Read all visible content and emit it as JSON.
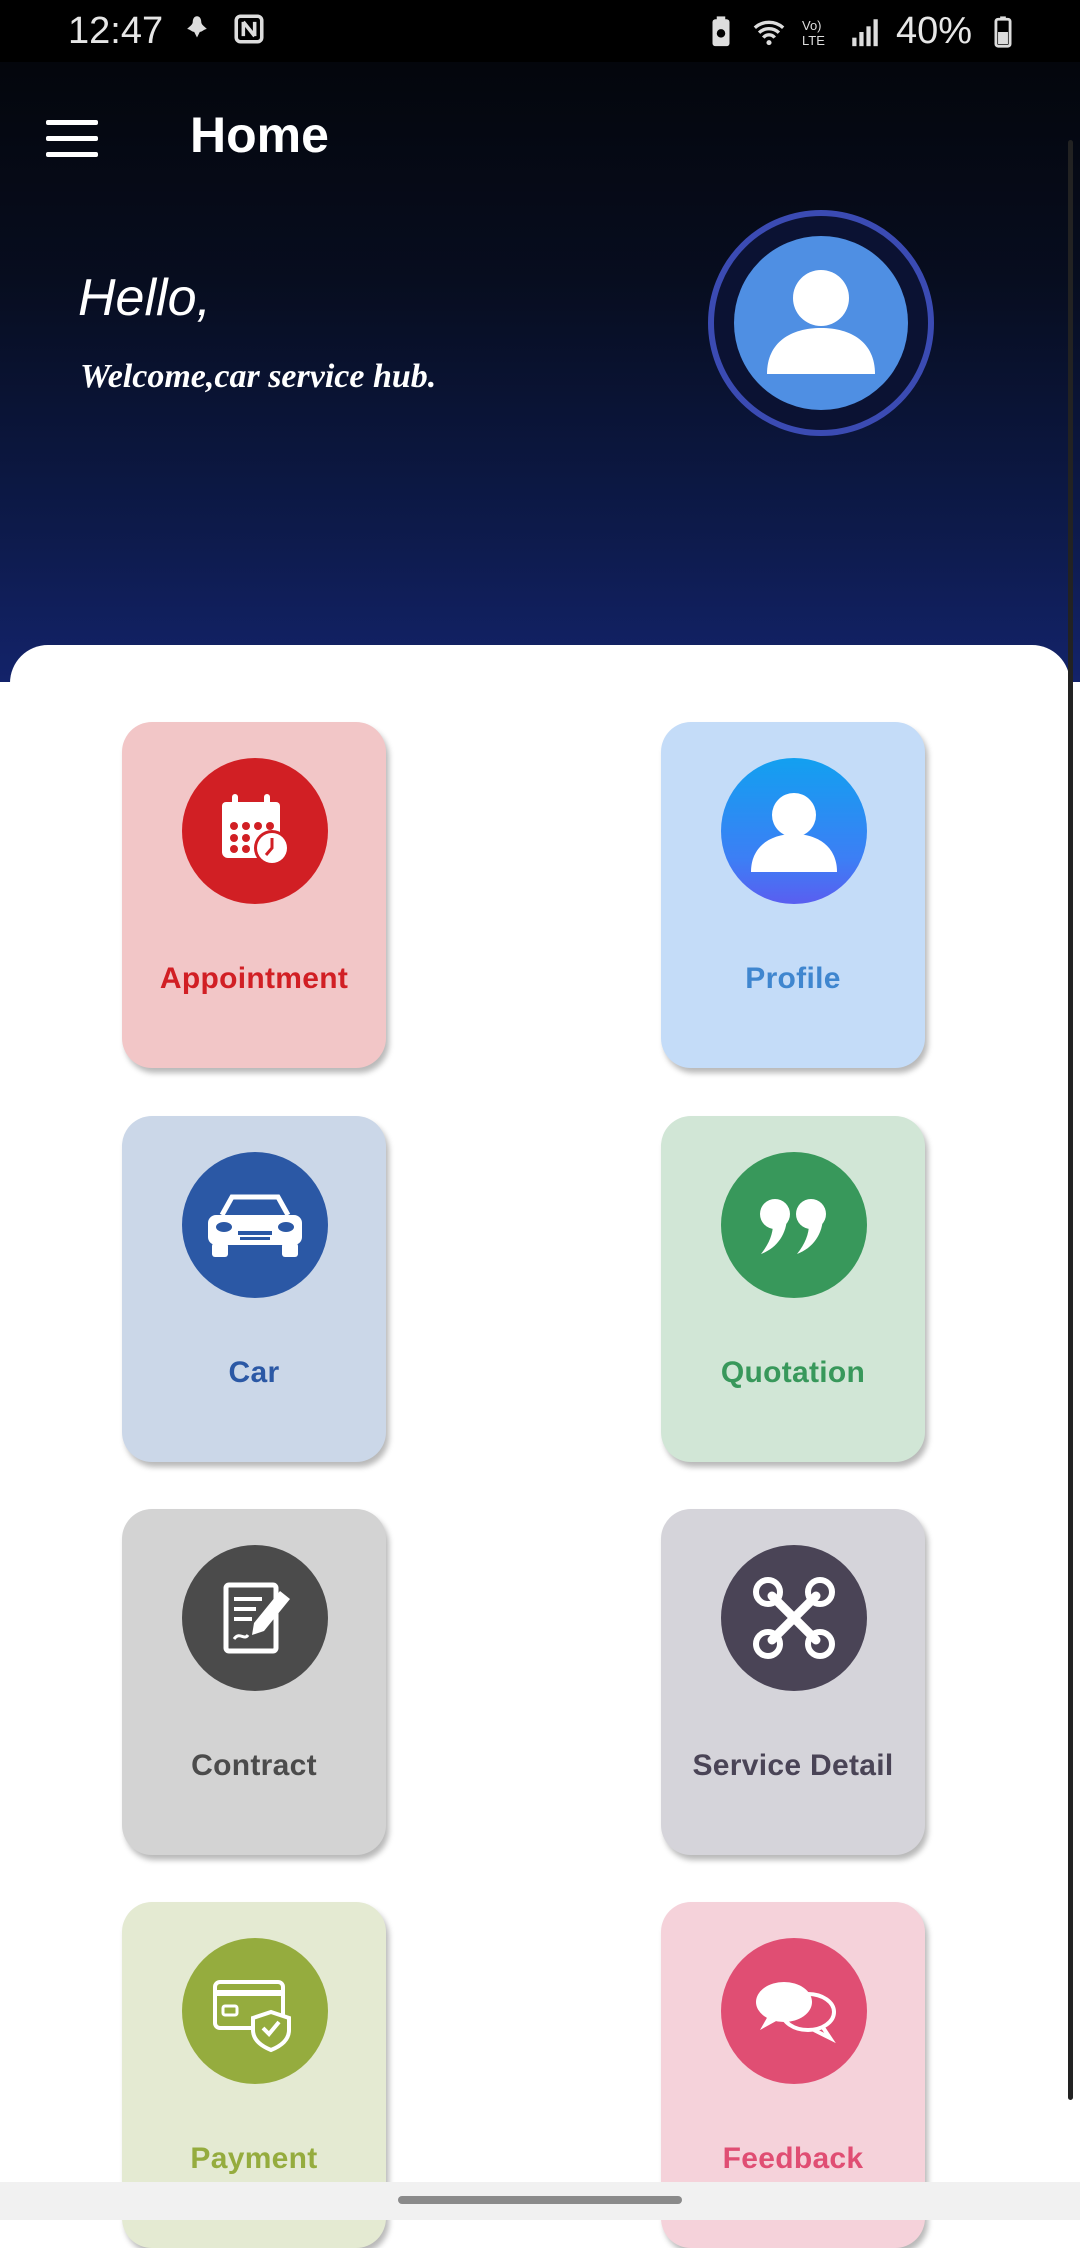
{
  "status_bar": {
    "time": "12:47",
    "battery": "40%",
    "icons": [
      "notification-icon",
      "nfc-icon",
      "battery-saver-icon",
      "wifi-icon",
      "volte-icon",
      "signal-icon",
      "battery-icon"
    ]
  },
  "header": {
    "title": "Home",
    "menu_icon": "hamburger-menu-icon"
  },
  "hero": {
    "greeting": "Hello,",
    "welcome": "Welcome,car service hub."
  },
  "tiles": [
    {
      "label": "Appointment",
      "icon": "calendar-clock-icon",
      "bg": "#f2c6c7",
      "circle": "#d11f24",
      "text": "#d11f24"
    },
    {
      "label": "Profile",
      "icon": "user-icon",
      "bg": "#c4dcf8",
      "circle": "#1d8df2",
      "text": "#3f86cf"
    },
    {
      "label": "Car",
      "icon": "car-icon",
      "bg": "#cbd7e8",
      "circle": "#2b58a5",
      "text": "#2b58a5"
    },
    {
      "label": "Quotation",
      "icon": "quote-icon",
      "bg": "#d1e6d6",
      "circle": "#38985b",
      "text": "#38985b"
    },
    {
      "label": "Contract",
      "icon": "document-sign-icon",
      "bg": "#d3d3d3",
      "circle": "#4b4b4b",
      "text": "#4b4b4b"
    },
    {
      "label": "Service Detail",
      "icon": "tools-icon",
      "bg": "#d5d4da",
      "circle": "#4a4456",
      "text": "#4a4456"
    },
    {
      "label": "Payment",
      "icon": "payment-card-shield-icon",
      "bg": "#e4ead2",
      "circle": "#95ac3e",
      "text": "#95ac3e"
    },
    {
      "label": "Feedback",
      "icon": "chat-bubbles-icon",
      "bg": "#f5d2da",
      "circle": "#e04e73",
      "text": "#e04e73"
    }
  ]
}
